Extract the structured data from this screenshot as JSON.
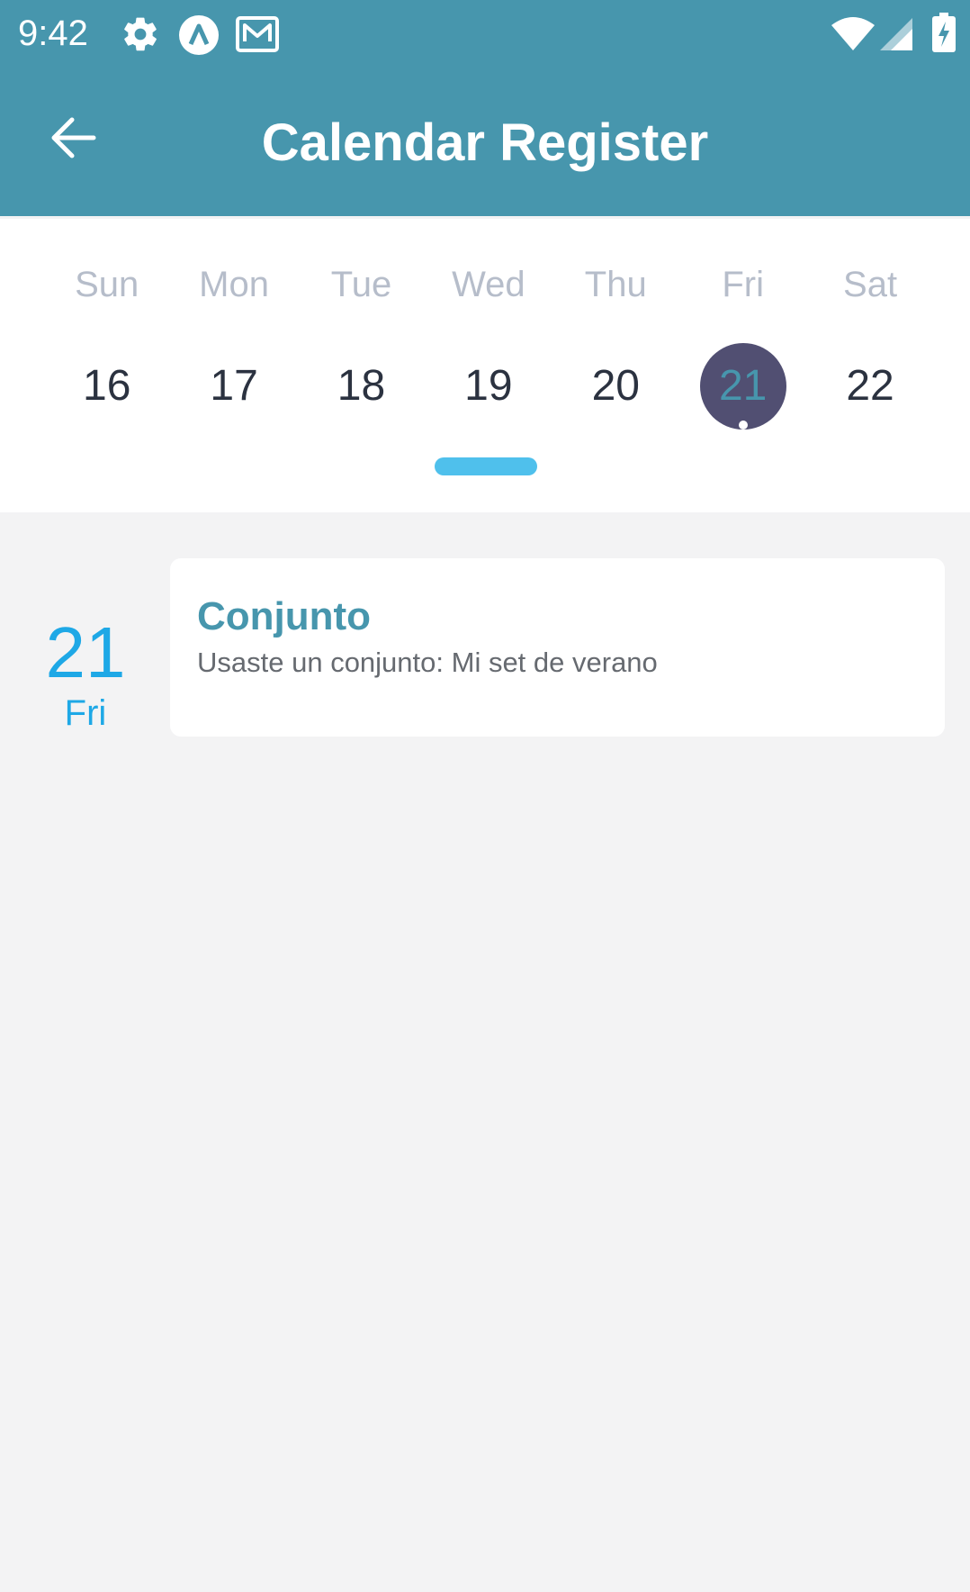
{
  "status_bar": {
    "time": "9:42",
    "icons": [
      "settings-icon",
      "app-a-icon",
      "mail-icon",
      "wifi-icon",
      "signal-icon",
      "battery-charging-icon"
    ]
  },
  "toolbar": {
    "back_icon": "arrow-left-icon",
    "title": "Calendar Register"
  },
  "week": {
    "weekdays": [
      "Sun",
      "Mon",
      "Tue",
      "Wed",
      "Thu",
      "Fri",
      "Sat"
    ],
    "dates": [
      "16",
      "17",
      "18",
      "19",
      "20",
      "21",
      "22"
    ],
    "selected_index": 5
  },
  "event": {
    "day_number": "21",
    "day_name": "Fri",
    "title": "Conjunto",
    "description": "Usaste un conjunto: Mi set de verano"
  },
  "colors": {
    "header": "#4796ad",
    "selected_circle": "#514f72",
    "accent_blue": "#1ea8e6",
    "handle": "#4fc0ec",
    "background": "#f3f3f4"
  }
}
